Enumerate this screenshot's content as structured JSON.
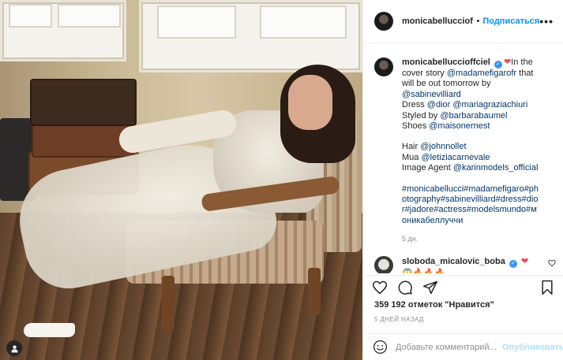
{
  "post": {
    "header": {
      "username": "monicabelluccioffic",
      "separator": "•",
      "follow_label": "Подписаться",
      "more_label": "•••"
    },
    "caption": {
      "username": "monicabelluccioffciel",
      "verified_mark": "✓",
      "heart": "❤",
      "lines": [
        "In the cover story @madamefigarofr that will be out tomorrow by @sabinevilliard",
        "Dress @dior @mariagraziachiuri",
        "Styled by @barbarabaumel",
        "Shoes @maisonernest",
        "",
        "Hair @johnnollet",
        "Mua @letiziacarnevale",
        "Image Agent @karinmodels_official",
        "",
        "#monicabellucci#madamefigaro#photography#sabinevilliard#dress#dior#jadore#actress#modelsmundo#моникабеллуччи"
      ],
      "time": "5 дн."
    },
    "comment": {
      "username": "sloboda_micalovic_boba",
      "verified_mark": "✓",
      "heart": "❤",
      "text": "😱🔥🔥🔥"
    },
    "likes_text": "359 192 отметок \"Нравится\"",
    "date_text": "5 ДНЕЙ НАЗАД",
    "add_comment": {
      "placeholder": "Добавьте комментарий...",
      "post_label": "Опубликовать"
    }
  },
  "colors": {
    "link": "#00376b",
    "follow": "#0095f6",
    "verified": "#3897f0",
    "heart": "#ed4956",
    "muted": "#8e8e8e"
  },
  "icons": {
    "user_tags": "user-icon",
    "like": "heart-outline-icon",
    "comment": "comment-bubble-icon",
    "share": "paper-plane-icon",
    "save": "bookmark-icon",
    "emoji": "smiley-icon"
  }
}
